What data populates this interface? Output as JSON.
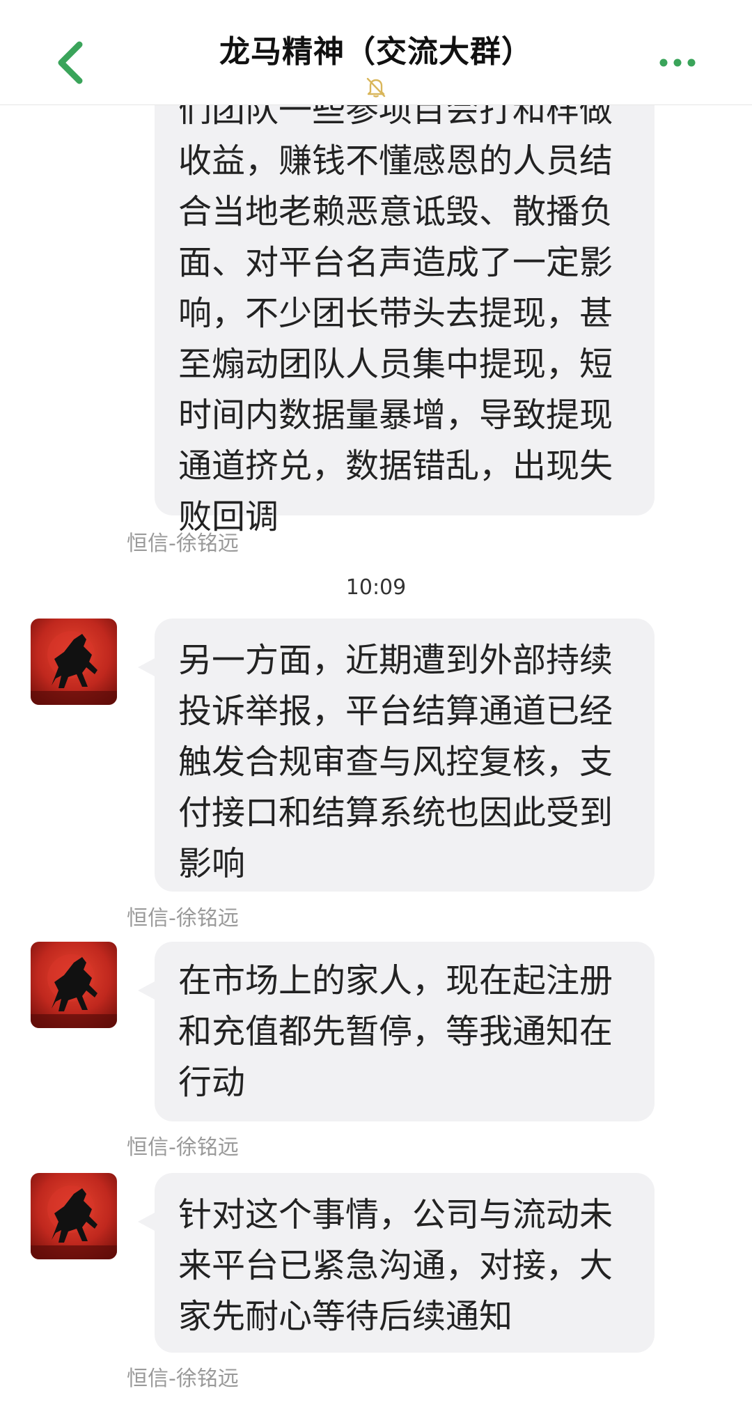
{
  "header": {
    "title": "龙马精神（交流大群）",
    "back_icon": "chevron-left-icon",
    "mute_icon": "bell-muted-icon",
    "more_icon": "more-dots-icon"
  },
  "messages": [
    {
      "lines": [
        "们团队一些参项目会打和样做",
        "收益，赚钱不懂感恩的人员结",
        "合当地老赖恶意诋毁、散播负",
        "面、对平台名声造成了一定影",
        "响，不少团长带头去提现，甚",
        "至煽动团队人员集中提现，短",
        "时间内数据量暴增，导致提现",
        "通道挤兑，数据错乱，出现失",
        "败回调"
      ],
      "sender": "恒信-徐铭远"
    },
    {
      "time": "10:09",
      "lines": [
        "另一方面，近期遭到外部持续",
        "投诉举报，平台结算通道已经",
        "触发合规审查与风控复核，支",
        "付接口和结算系统也因此受到",
        "影响"
      ],
      "sender": "恒信-徐铭远"
    },
    {
      "lines": [
        "在市场上的家人，现在起注册",
        "和充值都先暂停，等我通知在",
        "行动"
      ],
      "sender": "恒信-徐铭远"
    },
    {
      "lines": [
        "针对这个事情，公司与流动未",
        "来平台已紧急沟通，对接，大",
        "家先耐心等待后续通知"
      ],
      "sender": "恒信-徐铭远"
    }
  ],
  "colors": {
    "accent_green": "#3aa45a",
    "bubble_bg": "#f1f1f3",
    "avatar_red": "#c0281e"
  }
}
